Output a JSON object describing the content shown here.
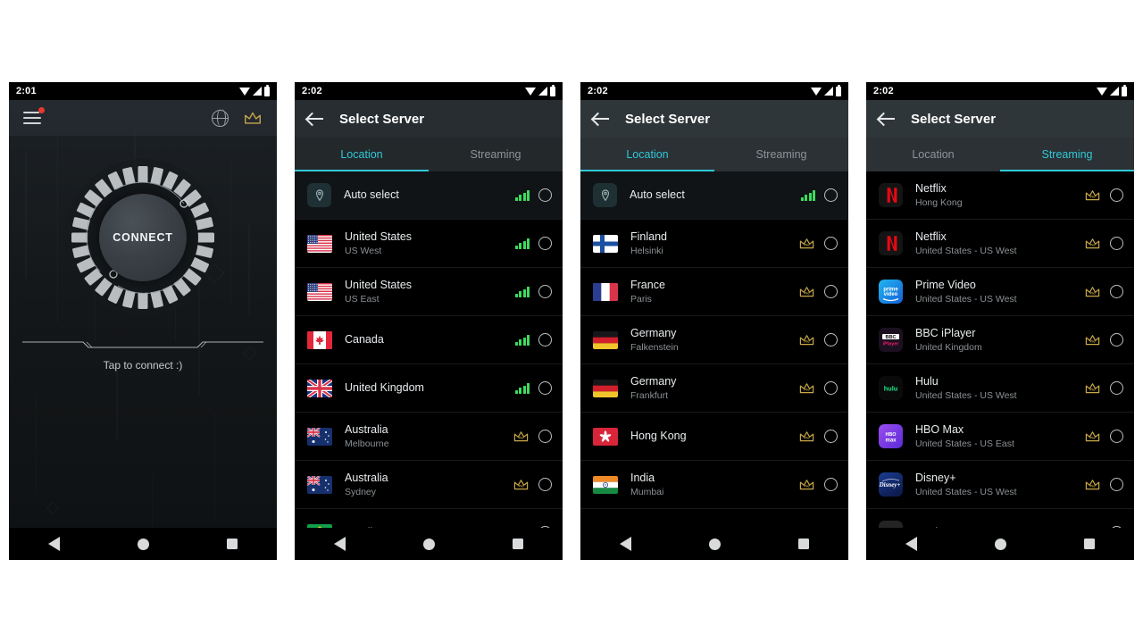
{
  "panels": [
    {
      "kind": "home",
      "status": {
        "time": "2:01"
      },
      "topbar": {
        "menu_icon": "hamburger-menu-icon",
        "badge": true,
        "globe_icon": "globe-icon",
        "crown_icon": "crown-icon"
      },
      "dial": {
        "label": "CONNECT",
        "segments": 28
      },
      "hint": "Tap to connect :)"
    },
    {
      "kind": "server",
      "tone": "a",
      "status": {
        "time": "2:02"
      },
      "title": "Select Server",
      "back_icon": "back-arrow-icon",
      "tabs": [
        {
          "label": "Location",
          "active": true
        },
        {
          "label": "Streaming",
          "active": false
        }
      ],
      "rows": [
        {
          "title": "Auto select",
          "sub": "",
          "icon": "location-pin-tile",
          "badge": "signal",
          "auto": true
        },
        {
          "title": "United States",
          "sub": "US West",
          "icon": "flag-us",
          "badge": "signal"
        },
        {
          "title": "United States",
          "sub": "US East",
          "icon": "flag-us",
          "badge": "signal"
        },
        {
          "title": "Canada",
          "sub": "",
          "icon": "flag-ca",
          "badge": "signal"
        },
        {
          "title": "United Kingdom",
          "sub": "",
          "icon": "flag-gb",
          "badge": "signal"
        },
        {
          "title": "Australia",
          "sub": "Melbourne",
          "icon": "flag-au",
          "badge": "pro"
        },
        {
          "title": "Australia",
          "sub": "Sydney",
          "icon": "flag-au",
          "badge": "pro"
        },
        {
          "title": "Brazil",
          "sub": "",
          "icon": "flag-br",
          "badge": "pro"
        }
      ]
    },
    {
      "kind": "server",
      "tone": "b",
      "status": {
        "time": "2:02"
      },
      "title": "Select Server",
      "back_icon": "back-arrow-icon",
      "tabs": [
        {
          "label": "Location",
          "active": true
        },
        {
          "label": "Streaming",
          "active": false
        }
      ],
      "rows": [
        {
          "title": "Auto select",
          "sub": "",
          "icon": "location-pin-tile",
          "badge": "signal",
          "auto": true
        },
        {
          "title": "Finland",
          "sub": "Helsinki",
          "icon": "flag-fi",
          "badge": "pro"
        },
        {
          "title": "France",
          "sub": "Paris",
          "icon": "flag-fr",
          "badge": "pro"
        },
        {
          "title": "Germany",
          "sub": "Falkenstein",
          "icon": "flag-de",
          "badge": "pro"
        },
        {
          "title": "Germany",
          "sub": "Frankfurt",
          "icon": "flag-de",
          "badge": "pro"
        },
        {
          "title": "Hong Kong",
          "sub": "",
          "icon": "flag-hk",
          "badge": "pro"
        },
        {
          "title": "India",
          "sub": "Mumbai",
          "icon": "flag-in",
          "badge": "pro"
        },
        {
          "title": "",
          "sub": "",
          "icon": "partial",
          "badge": "none"
        }
      ]
    },
    {
      "kind": "server",
      "tone": "b",
      "status": {
        "time": "2:02"
      },
      "title": "Select Server",
      "back_icon": "back-arrow-icon",
      "tabs": [
        {
          "label": "Location",
          "active": false
        },
        {
          "label": "Streaming",
          "active": true
        }
      ],
      "rows": [
        {
          "title": "Netflix",
          "sub": "Hong Kong",
          "icon": "logo-netflix",
          "badge": "pro"
        },
        {
          "title": "Netflix",
          "sub": "United States - US West",
          "icon": "logo-netflix",
          "badge": "pro"
        },
        {
          "title": "Prime Video",
          "sub": "United States - US West",
          "icon": "logo-prime",
          "badge": "pro"
        },
        {
          "title": "BBC iPlayer",
          "sub": "United Kingdom",
          "icon": "logo-bbc",
          "badge": "pro"
        },
        {
          "title": "Hulu",
          "sub": "United States - US West",
          "icon": "logo-hulu",
          "badge": "pro"
        },
        {
          "title": "HBO Max",
          "sub": "United States - US East",
          "icon": "logo-hbo",
          "badge": "pro"
        },
        {
          "title": "Disney+",
          "sub": "United States - US West",
          "icon": "logo-disney",
          "badge": "pro"
        },
        {
          "title": "Apple TV+",
          "sub": "",
          "icon": "logo-appletv",
          "badge": "pro"
        }
      ]
    }
  ],
  "navbar": {
    "back_icon": "nav-back-icon",
    "home_icon": "nav-home-icon",
    "recents_icon": "nav-recents-icon"
  },
  "colors": {
    "accent": "#31c8d8",
    "pro_gold": "#c9a84a",
    "signal_green": "#3ddb5c",
    "badge_red": "#e8392f",
    "bg_black": "#000000"
  },
  "pro_label": "Pro"
}
